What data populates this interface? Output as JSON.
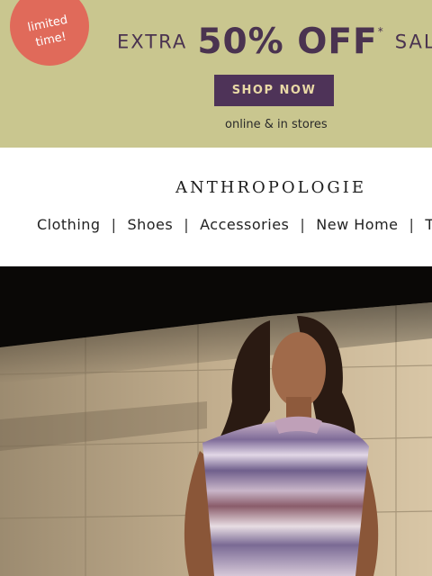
{
  "banner": {
    "badge": "limited time!",
    "lead": "EXTRA",
    "highlight": "50% OFF",
    "asterisk": "*",
    "tail": "SALE",
    "button": "SHOP NOW",
    "subtext": "online & in stores"
  },
  "brand": "ANTHROPOLOGIE",
  "nav": {
    "items": [
      "Clothing",
      "Shoes",
      "Accessories",
      "New Home",
      "T"
    ],
    "separator": "|"
  },
  "colors": {
    "banner_bg": "#c9c68f",
    "badge": "#e06a5a",
    "button_bg": "#4e3358",
    "promo_text": "#4a3350"
  }
}
